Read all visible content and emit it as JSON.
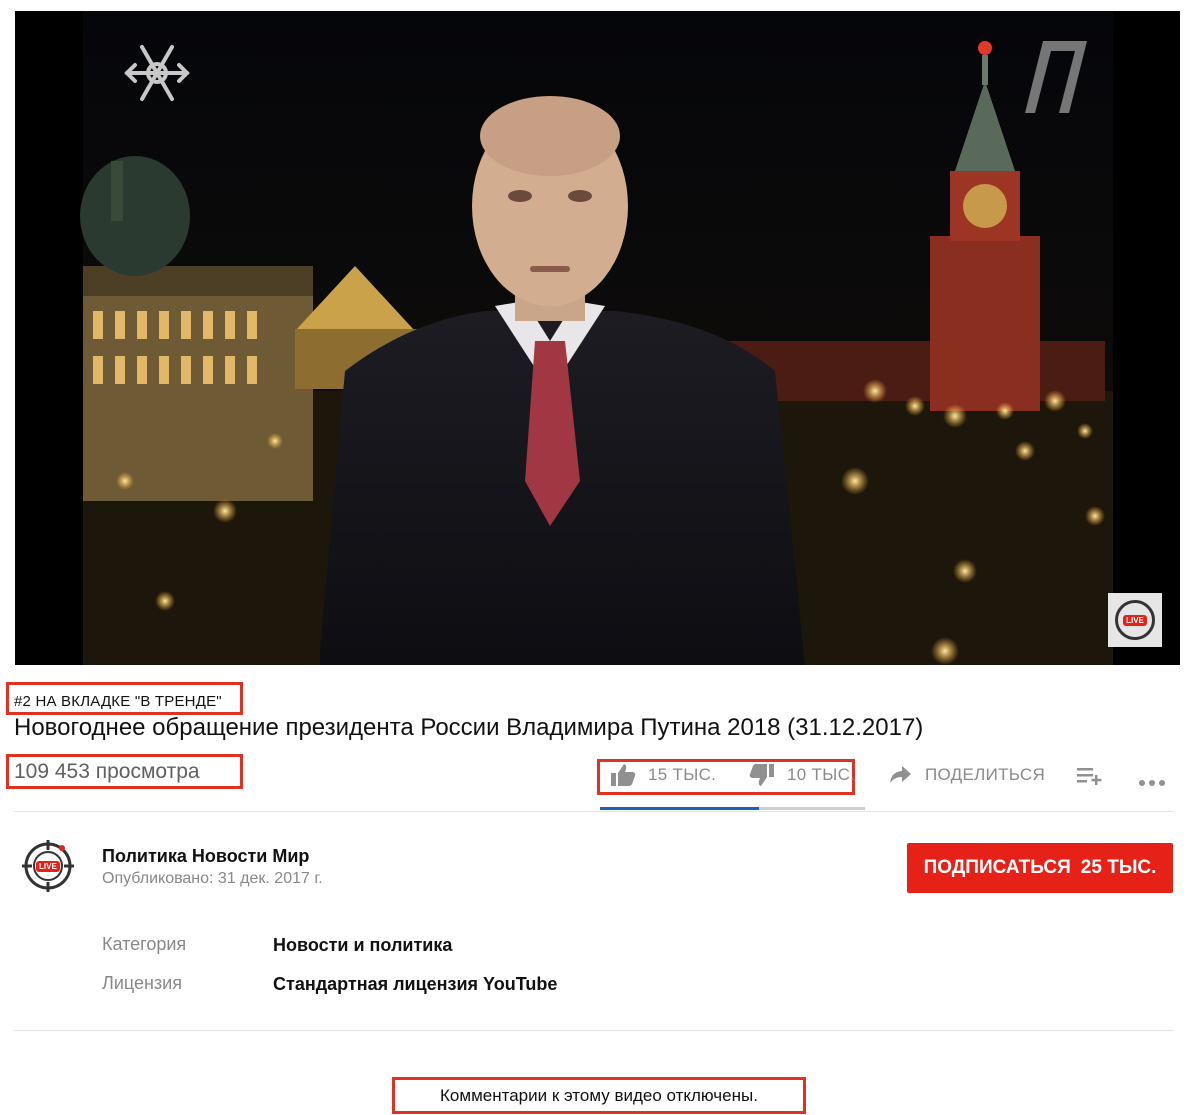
{
  "trending_label": "#2 НА ВКЛАДКЕ \"В ТРЕНДЕ\"",
  "video": {
    "title": "Новогоднее обращение президента России Владимира Путина 2018 (31.12.2017)",
    "views": "109 453 просмотра",
    "overlay_badge": "LIVE"
  },
  "actions": {
    "likes": "15 ТЫС.",
    "dislikes": "10 ТЫС.",
    "share": "ПОДЕЛИТЬСЯ",
    "like_ratio": 0.6
  },
  "channel": {
    "name": "Политика Новости Мир",
    "published": "Опубликовано: 31 дек. 2017 г.",
    "avatar_badge": "LIVE",
    "subscribe_label": "ПОДПИСАТЬСЯ",
    "subscriber_count": "25 ТЫС."
  },
  "meta": {
    "category_label": "Категория",
    "category_value": "Новости и политика",
    "license_label": "Лицензия",
    "license_value": "Стандартная лицензия YouTube"
  },
  "comments_disabled": "Комментарии к этому видео отключены.",
  "colors": {
    "accent_red": "#e62117",
    "annotation_red": "#e03222",
    "like_bar_blue": "#1c62b9"
  },
  "icons": [
    "snowflake-icon",
    "channel-one-logo-icon",
    "thumbs-up-icon",
    "thumbs-down-icon",
    "share-arrow-icon",
    "add-to-playlist-icon",
    "more-dots-icon"
  ]
}
